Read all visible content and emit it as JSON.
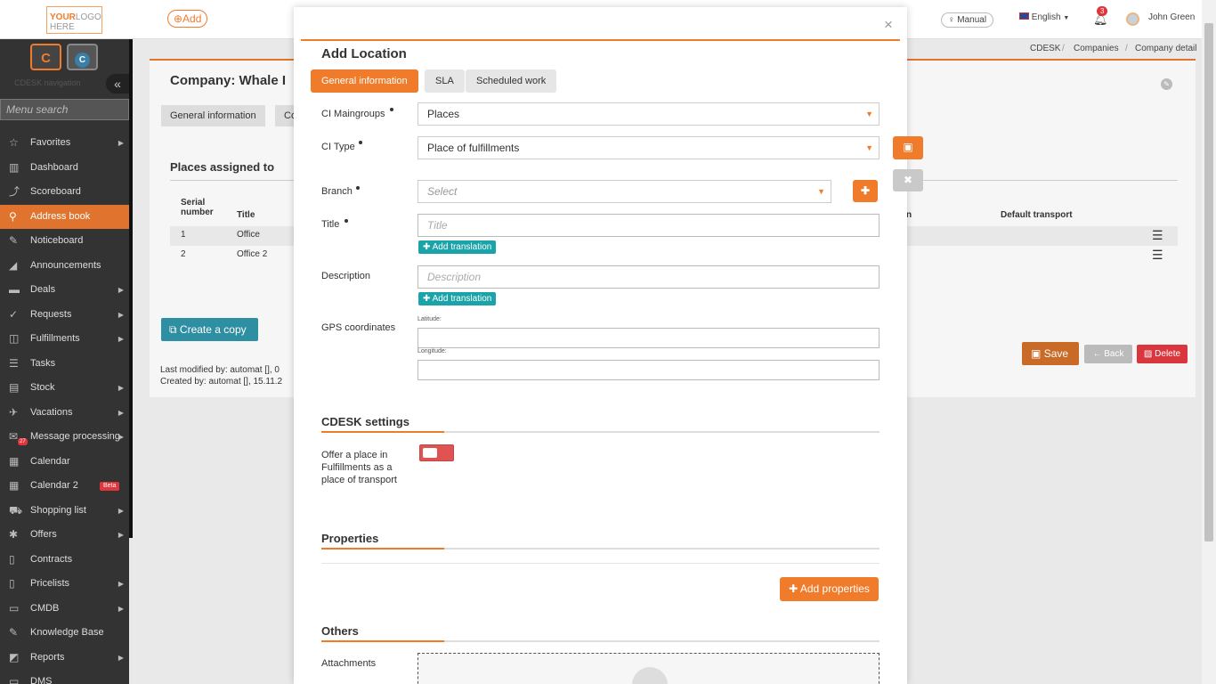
{
  "topbar": {
    "logo": {
      "your": "YOUR",
      "logo": "LOGO",
      "sub": "HERE"
    },
    "add_label": "⊕Add",
    "manual_label": "Manual",
    "language": "English",
    "notification_count": "3",
    "user_name": "John Green"
  },
  "sidebar": {
    "caption": "CDESK navigation",
    "search_placeholder": "Menu search",
    "items": [
      {
        "label": "Favorites",
        "icon": "☆"
      },
      {
        "label": "Dashboard",
        "icon": "▥"
      },
      {
        "label": "Scoreboard",
        "icon": "⤴"
      },
      {
        "label": "Address book",
        "icon": "⚲"
      },
      {
        "label": "Noticeboard",
        "icon": "✎"
      },
      {
        "label": "Announcements",
        "icon": "◢"
      },
      {
        "label": "Deals",
        "icon": "▬"
      },
      {
        "label": "Requests",
        "icon": "✓"
      },
      {
        "label": "Fulfillments",
        "icon": "◫"
      },
      {
        "label": "Tasks",
        "icon": "☰"
      },
      {
        "label": "Stock",
        "icon": "▤"
      },
      {
        "label": "Vacations",
        "icon": "✈"
      },
      {
        "label": "Message processing",
        "icon": "✉",
        "badge": "27"
      },
      {
        "label": "Calendar",
        "icon": "▦"
      },
      {
        "label": "Calendar 2",
        "icon": "▦",
        "beta": "Beta"
      },
      {
        "label": "Shopping list",
        "icon": "⛟"
      },
      {
        "label": "Offers",
        "icon": "✱"
      },
      {
        "label": "Contracts",
        "icon": "▯"
      },
      {
        "label": "Pricelists",
        "icon": "▯"
      },
      {
        "label": "CMDB",
        "icon": "▭"
      },
      {
        "label": "Knowledge Base",
        "icon": "✎"
      },
      {
        "label": "Reports",
        "icon": "◩"
      },
      {
        "label": "DMS",
        "icon": "▭"
      }
    ]
  },
  "breadcrumb": [
    "CDESK",
    "Companies",
    "Company detail"
  ],
  "page": {
    "title": "Company: Whale I",
    "tabs": [
      "General information",
      "Co"
    ],
    "places_heading": "Places assigned to",
    "columns": {
      "serial_number": "Serial number",
      "title": "Title",
      "n": "n",
      "default_transport": "Default transport"
    },
    "rows": [
      {
        "num": "1",
        "title": "Office"
      },
      {
        "num": "2",
        "title": "Office 2"
      }
    ],
    "create_copy": "Create a copy",
    "last_modified": "Last modified by: automat  [], 0",
    "created_by": "Created by: automat  [], 15.11.2",
    "save": "Save",
    "back": "← Back",
    "delete": "Delete"
  },
  "modal": {
    "title": "Add Location",
    "close": "×",
    "tabs": [
      "General information",
      "SLA",
      "Scheduled work"
    ],
    "ci_maingroups": {
      "label": "CI Maingroups",
      "value": "Places"
    },
    "ci_type": {
      "label": "CI Type",
      "value": "Place of fulfillments"
    },
    "branch": {
      "label": "Branch",
      "placeholder": "Select"
    },
    "title_field": {
      "label": "Title",
      "placeholder": "Title"
    },
    "description_field": {
      "label": "Description",
      "placeholder": "Description"
    },
    "add_translation": "Add translation",
    "gps": {
      "label": "GPS coordinates",
      "latitude": "Latitude:",
      "longitude": "Longitude:"
    },
    "cdesk_settings": "CDESK settings",
    "offer_place_label": "Offer a place in Fulfillments as a place of transport",
    "offer_place_enabled": false,
    "properties": "Properties",
    "add_properties": "Add properties",
    "others": "Others",
    "attachments": "Attachments"
  }
}
